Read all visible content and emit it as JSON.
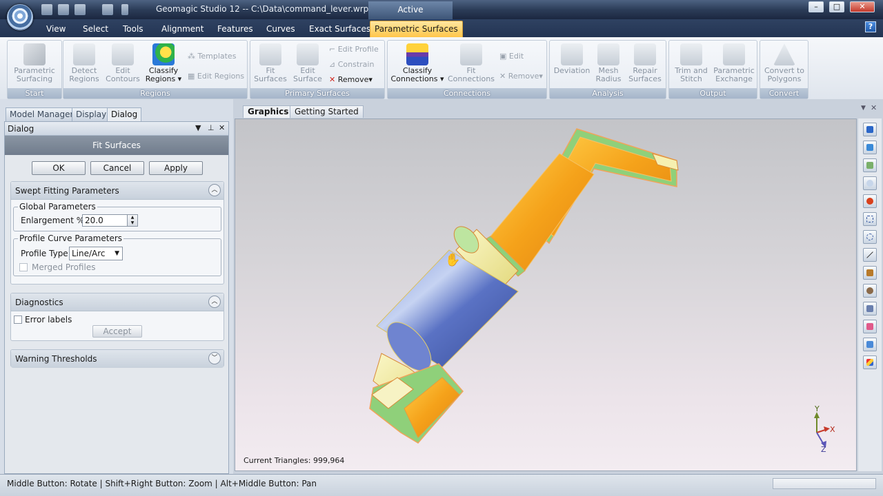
{
  "window": {
    "title": "Geomagic Studio 12 -- C:\\Data\\command_lever.wrp",
    "status_tab": "Active",
    "min_symbol": "–",
    "max_symbol": "□",
    "close_symbol": "✕",
    "help_symbol": "?"
  },
  "menu": {
    "tabs": [
      "View",
      "Select",
      "Tools",
      "Alignment",
      "Features",
      "Curves",
      "Exact Surfaces",
      "Parametric Surfaces"
    ],
    "active_tab": "Parametric Surfaces"
  },
  "ribbon": {
    "start": {
      "label": "Start",
      "parametric_surfacing": [
        "Parametric",
        "Surfacing"
      ]
    },
    "regions": {
      "label": "Regions",
      "detect_regions": [
        "Detect",
        "Regions"
      ],
      "edit_contours": [
        "Edit",
        "Contours"
      ],
      "classify_regions": [
        "Classify",
        "Regions"
      ],
      "templates": "Templates",
      "edit_regions": "Edit Regions"
    },
    "primary_surfaces": {
      "label": "Primary Surfaces",
      "fit_surfaces": [
        "Fit",
        "Surfaces"
      ],
      "edit_surface": [
        "Edit",
        "Surface"
      ],
      "edit_profile": "Edit Profile",
      "constrain": "Constrain",
      "remove": "Remove"
    },
    "connections": {
      "label": "Connections",
      "classify_connections": [
        "Classify",
        "Connections"
      ],
      "fit_connections": [
        "Fit",
        "Connections"
      ],
      "edit": "Edit",
      "remove": "Remove"
    },
    "analysis": {
      "label": "Analysis",
      "deviation": "Deviation",
      "mesh_radius": [
        "Mesh",
        "Radius"
      ],
      "repair_surfaces": [
        "Repair",
        "Surfaces"
      ]
    },
    "output": {
      "label": "Output",
      "trim_and_stitch": [
        "Trim and",
        "Stitch"
      ],
      "parametric_exchange": [
        "Parametric",
        "Exchange"
      ]
    },
    "convert": {
      "label": "Convert",
      "convert_to_polygons": [
        "Convert to",
        "Polygons"
      ]
    }
  },
  "left_panel": {
    "tabs": [
      "Model Manager",
      "Display",
      "Dialog"
    ],
    "active_tab": "Dialog",
    "dialog_title": "Dialog",
    "command_title": "Fit Surfaces",
    "buttons": {
      "ok": "OK",
      "cancel": "Cancel",
      "apply": "Apply"
    },
    "swept": {
      "title": "Swept Fitting Parameters",
      "global_legend": "Global Parameters",
      "enlargement_label": "Enlargement %:",
      "enlargement_value": "20.0",
      "profile_legend": "Profile Curve Parameters",
      "profile_type_label": "Profile Type:",
      "profile_type_value": "Line/Arc",
      "merged_profiles": "Merged Profiles"
    },
    "diagnostics": {
      "title": "Diagnostics",
      "error_labels": "Error labels",
      "accept": "Accept"
    },
    "warning": {
      "title": "Warning Thresholds"
    }
  },
  "graphics": {
    "tabs": [
      "Graphics",
      "Getting Started"
    ],
    "active_tab": "Graphics",
    "triangles": "Current Triangles: 999,964",
    "axis": {
      "x": "X",
      "y": "Y",
      "z": "Z"
    }
  },
  "status": {
    "text": "Middle Button: Rotate | Shift+Right Button: Zoom | Alt+Middle Button: Pan"
  },
  "colors": {
    "accent": "#ffc64a",
    "model_blue": "#5a72c4",
    "model_orange": "#f5a21a",
    "model_yellow": "#f2ec9a",
    "model_green": "#8fd07a"
  }
}
